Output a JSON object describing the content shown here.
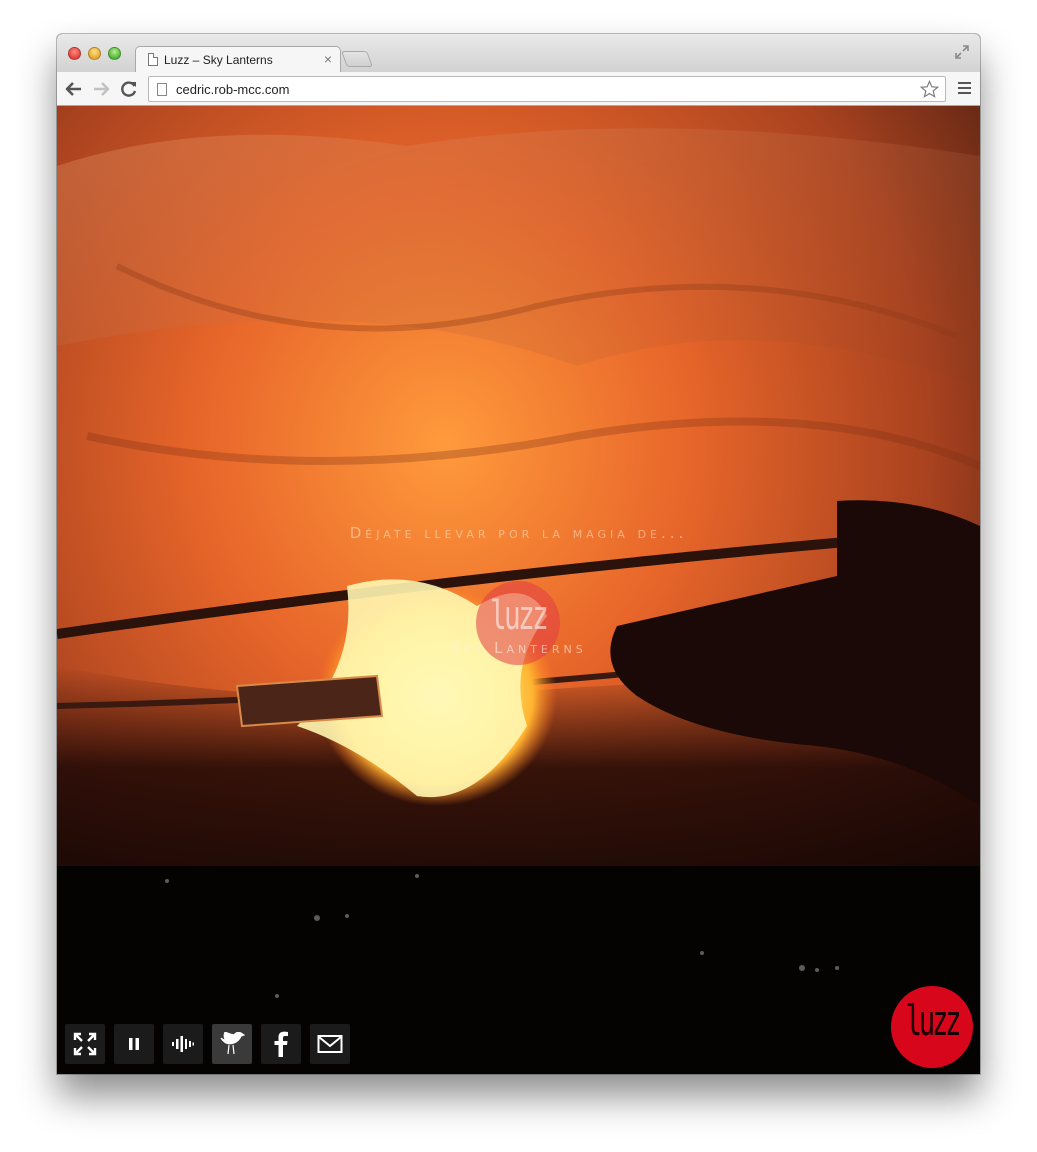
{
  "browser": {
    "tab_title": "Luzz – Sky Lanterns",
    "tab_close_glyph": "×",
    "url": "cedric.rob-mcc.com",
    "icons": [
      "close-window-icon",
      "minimize-window-icon",
      "maximize-window-icon",
      "page-icon",
      "fullscreen-icon",
      "back-arrow-icon",
      "forward-arrow-icon",
      "reload-icon",
      "star-icon",
      "menu-icon"
    ]
  },
  "video": {
    "tagline": "Déjate llevar por la magia de...",
    "logo_text": "luzz",
    "subtitle": "Sky Lanterns",
    "corner_logo_text": "luzz",
    "colors": {
      "accent_red": "#d8061a",
      "control_bg": "#1b1b1b"
    }
  },
  "controls": [
    {
      "name": "fullscreen-button",
      "icon": "expand-arrows-icon"
    },
    {
      "name": "pause-button",
      "icon": "pause-icon"
    },
    {
      "name": "sound-button",
      "icon": "sound-wave-icon"
    },
    {
      "name": "twitter-button",
      "icon": "twitter-bird-icon"
    },
    {
      "name": "facebook-button",
      "icon": "facebook-icon"
    },
    {
      "name": "email-button",
      "icon": "envelope-icon"
    }
  ]
}
